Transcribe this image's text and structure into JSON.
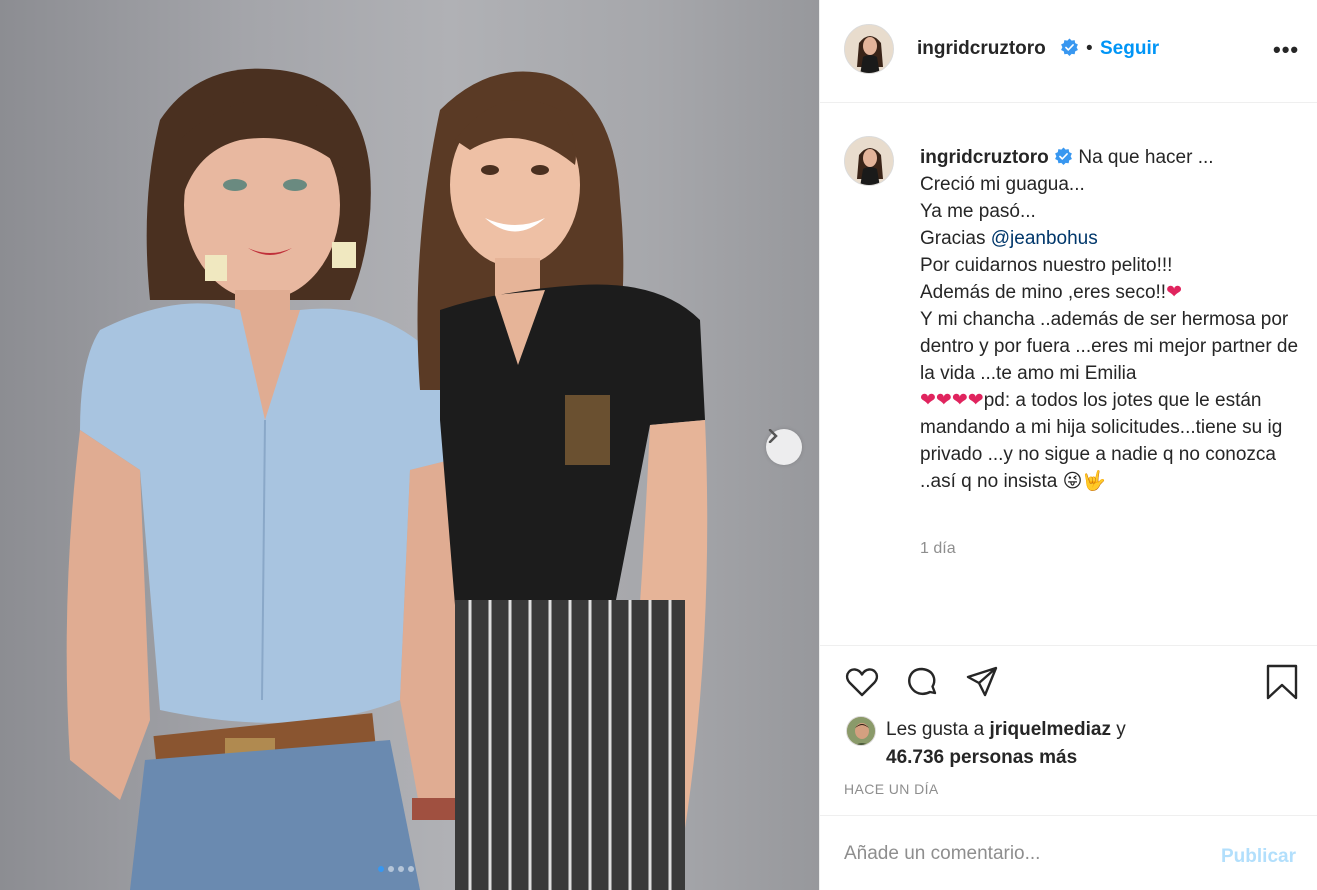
{
  "post": {
    "username": "ingridcruztoro",
    "follow_label": "Seguir",
    "more_label": "•••",
    "separator": "•"
  },
  "caption": {
    "username": "ingridcruztoro",
    "line1": "Na que hacer ...",
    "line2": "Creció mi guagua...",
    "line3": "Ya me pasó...",
    "line4_prefix": "Gracias ",
    "mention": "@jeanbohus",
    "line5": "Por cuidarnos nuestro pelito!!!",
    "line6": "Además de mino ,eres seco!!",
    "line7": "Y mi chancha ..además de ser hermosa por dentro y por fuera ...eres mi mejor partner de la vida ...te amo mi Emilia",
    "line8": "pd: a todos los jotes que le están mandando a mi hija solicitudes...tiene su ig privado ...y no sigue a nadie q no conozca ..así q no insista ",
    "emoji_heart": "❤",
    "emoji_wink": "😜",
    "emoji_hand": "🤟",
    "time": "1 día"
  },
  "likes": {
    "prefix": "Les gusta a ",
    "user": "jriquelmediaz",
    "connector": " y",
    "count_text": "46.736 personas más"
  },
  "timestamp": "HACE UN DÍA",
  "comment": {
    "placeholder": "Añade un comentario...",
    "publish_label": "Publicar"
  },
  "carousel": {
    "total": 4,
    "active_index": 0
  },
  "colors": {
    "accent": "#0095f6",
    "verified": "#3897f0",
    "publish_disabled": "#b2dffc",
    "muted": "#8e8e8e"
  },
  "icons": [
    "verified-badge-icon",
    "heart-icon",
    "comment-icon",
    "share-icon",
    "bookmark-icon",
    "chevron-right-icon",
    "more-icon"
  ]
}
